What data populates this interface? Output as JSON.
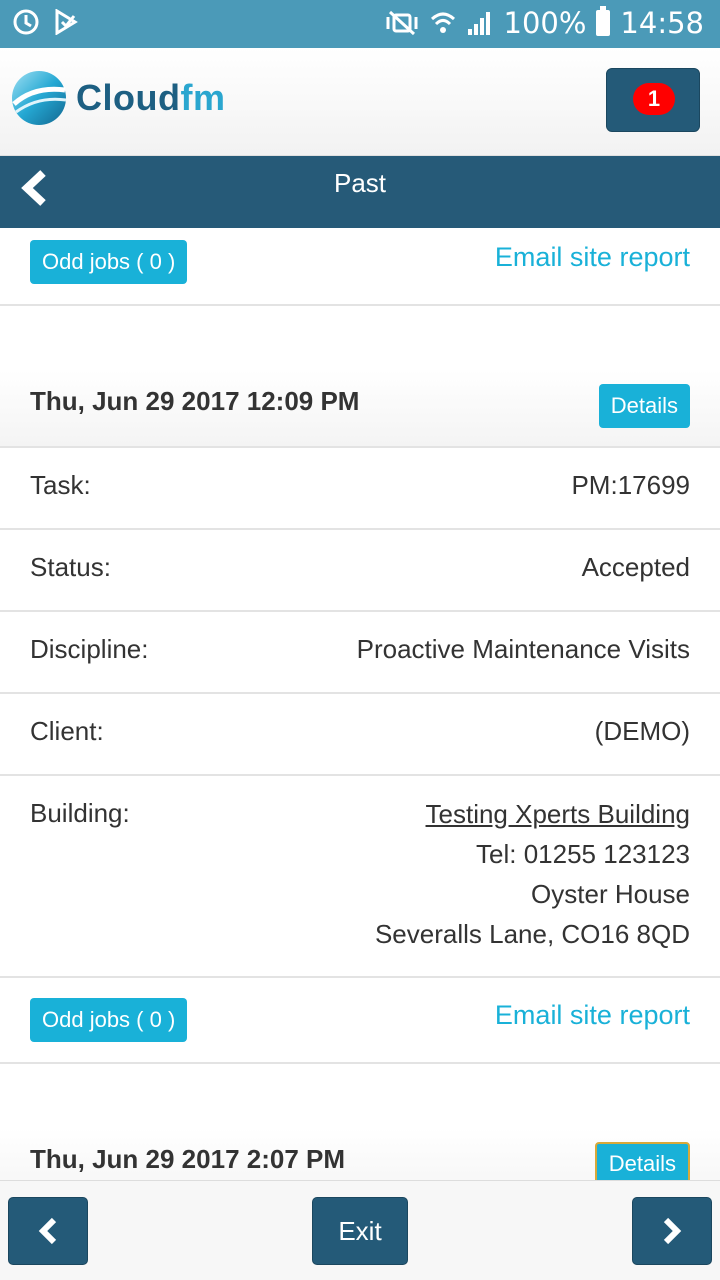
{
  "status_bar": {
    "battery": "100%",
    "time": "14:58"
  },
  "header": {
    "logo_main": "Cloud",
    "logo_accent": "fm",
    "notification_count": "1"
  },
  "nav": {
    "title": "Past"
  },
  "top_actions": {
    "odd_jobs_label": "Odd jobs ( 0 )",
    "email_label": "Email site report"
  },
  "jobs": [
    {
      "date": "Thu, Jun 29 2017 12:09 PM",
      "details_label": "Details",
      "task_label": "Task:",
      "task_value": "PM:17699",
      "status_label": "Status:",
      "status_value": "Accepted",
      "discipline_label": "Discipline:",
      "discipline_value": "Proactive Maintenance Visits",
      "client_label": "Client:",
      "client_value": "(DEMO)",
      "building_label": "Building:",
      "building_name": "Testing Xperts Building",
      "building_tel": "Tel: 01255 123123",
      "building_line1": "Oyster House",
      "building_line2": "Severalls Lane, CO16 8QD",
      "odd_jobs_label": "Odd jobs ( 0 )",
      "email_label": "Email site report"
    },
    {
      "date": "Thu, Jun 29 2017 2:07 PM",
      "details_label": "Details"
    }
  ],
  "footer": {
    "exit_label": "Exit"
  },
  "colors": {
    "status_bar": "#4b9ab8",
    "nav_bar": "#265a78",
    "accent": "#19b1d8",
    "badge": "#ff0000"
  }
}
